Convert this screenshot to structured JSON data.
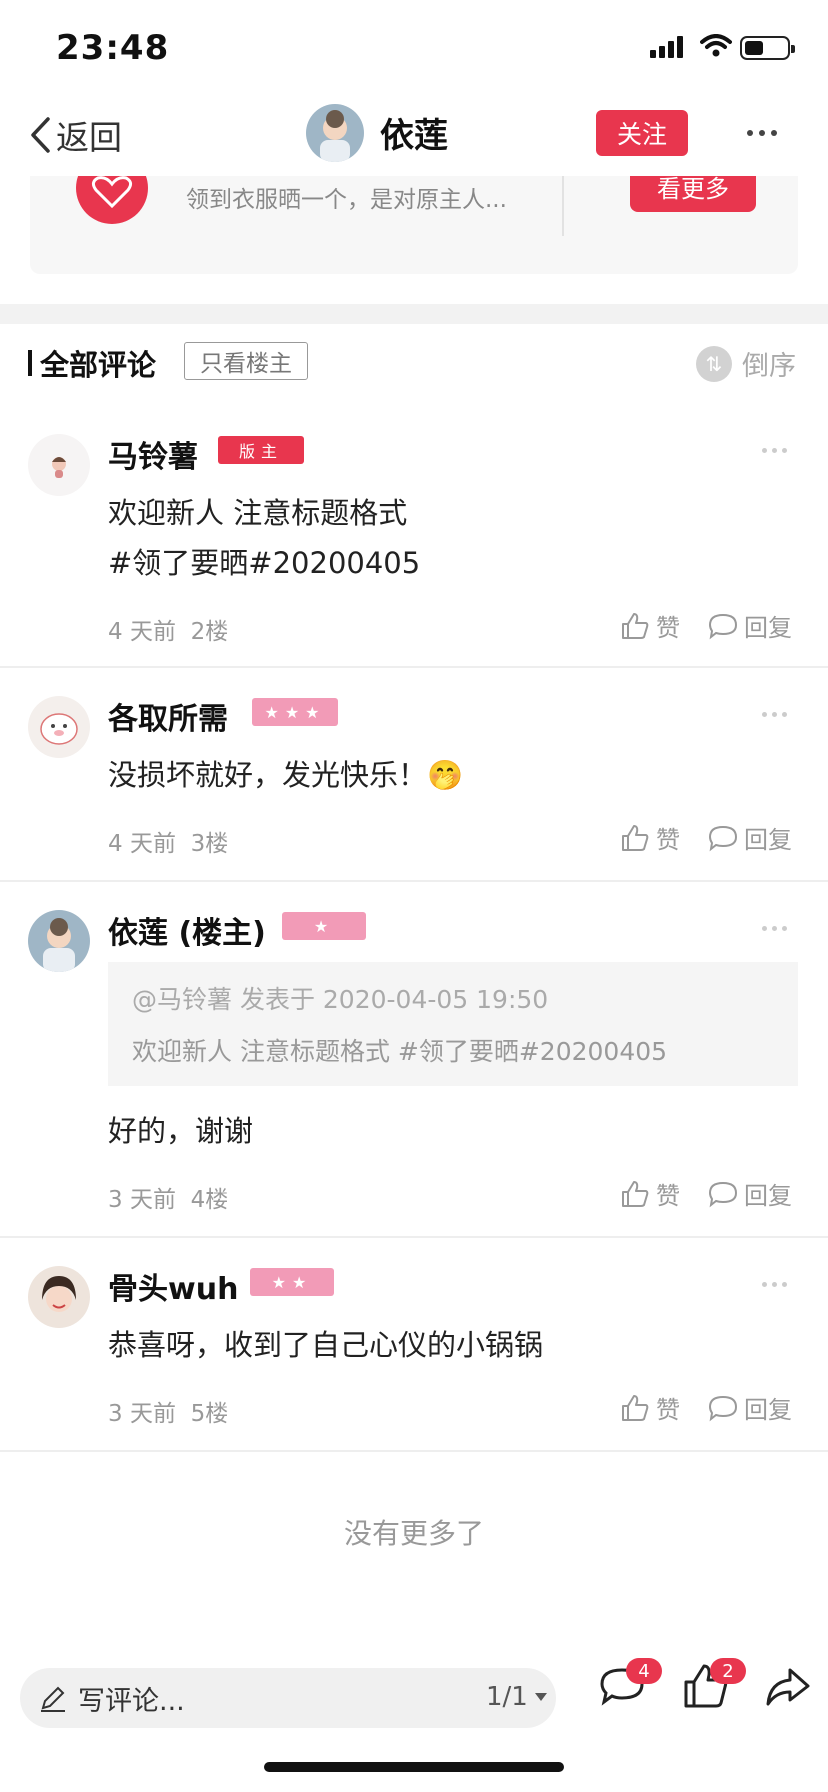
{
  "status": {
    "time": "23:48"
  },
  "nav": {
    "back_label": "返回",
    "title": "依莲",
    "follow_label": "关注"
  },
  "card": {
    "desc": "领到衣服晒一个，是对原主人...",
    "button_label": "看更多"
  },
  "section": {
    "title": "全部评论",
    "only_op_label": "只看楼主",
    "sort_label": "倒序"
  },
  "comments": [
    {
      "user": "马铃薯",
      "badge": "版主",
      "text_lines": [
        "欢迎新人 注意标题格式",
        "#领了要晒#20200405"
      ],
      "time": "4 天前",
      "floor": "2楼",
      "like_label": "赞",
      "reply_label": "回复"
    },
    {
      "user": "各取所需",
      "badge": "★★★",
      "text_lines": [
        "没损坏就好，发光快乐！🤭"
      ],
      "time": "4 天前",
      "floor": "3楼",
      "like_label": "赞",
      "reply_label": "回复"
    },
    {
      "user": "依莲 (楼主)",
      "badge": "★",
      "quote_head": "@马铃薯 发表于 2020-04-05 19:50",
      "quote_body": "欢迎新人 注意标题格式 #领了要晒#20200405",
      "text_lines": [
        "好的，谢谢"
      ],
      "time": "3 天前",
      "floor": "4楼",
      "like_label": "赞",
      "reply_label": "回复"
    },
    {
      "user": "骨头wuh",
      "badge": "★★",
      "text_lines": [
        "恭喜呀，收到了自己心仪的小锅锅"
      ],
      "time": "3 天前",
      "floor": "5楼",
      "like_label": "赞",
      "reply_label": "回复"
    }
  ],
  "no_more": "没有更多了",
  "bottom": {
    "write_placeholder": "写评论...",
    "page_indicator": "1/1",
    "comment_count": "4",
    "like_count": "2"
  },
  "colors": {
    "accent": "#e8364e",
    "badge_pink": "#f29bb7"
  }
}
